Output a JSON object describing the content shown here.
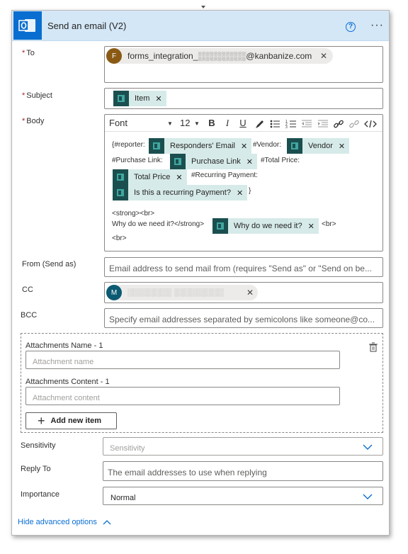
{
  "header": {
    "title": "Send an email (V2)",
    "help": "?",
    "more": "···"
  },
  "to": {
    "label": "To",
    "chip_initial": "F",
    "chip_text": "forms_integration_░░░░░░░░@kanbanize.com"
  },
  "subject": {
    "label": "Subject",
    "token": "Item"
  },
  "body": {
    "label": "Body",
    "toolbar": {
      "font": "Font",
      "size": "12",
      "bold": "B",
      "italic": "I",
      "underline": "U"
    },
    "text_reporter": "{#reporter:",
    "token_responders": "Responders' Email",
    "text_vendor": "#Vendor:",
    "token_vendor": "Vendor",
    "text_purchase": "#Purchase Link:",
    "token_purchase": "Purchase Link",
    "text_total": "#Total Price:",
    "token_total": "Total Price",
    "text_recurring": "#Recurring Payment:",
    "token_recurring": "Is this a recurring Payment?",
    "text_close": "}",
    "text_strong": "<strong><br>",
    "text_why": "Why do we need it?</strong>",
    "token_why": "Why do we need it?",
    "text_br1": "<br>",
    "text_br2": "<br>"
  },
  "from": {
    "label": "From (Send as)",
    "placeholder": "Email address to send mail from (requires \"Send as\" or \"Send on be..."
  },
  "cc": {
    "label": "CC",
    "chip_initial": "M",
    "chip_text": "░░░░░░░░ ░░░░░░░░░"
  },
  "bcc": {
    "label": "BCC",
    "placeholder": "Specify email addresses separated by semicolons like someone@co..."
  },
  "attachments": {
    "name_label": "Attachments Name - 1",
    "name_placeholder": "Attachment name",
    "content_label": "Attachments Content - 1",
    "content_placeholder": "Attachment content",
    "add_label": "Add new item"
  },
  "sensitivity": {
    "label": "Sensitivity",
    "placeholder": "Sensitivity"
  },
  "reply_to": {
    "label": "Reply To",
    "placeholder": "The email addresses to use when replying"
  },
  "importance": {
    "label": "Importance",
    "value": "Normal"
  },
  "advanced": {
    "label": "Hide advanced options"
  },
  "colors": {
    "accent": "#0a6ed1",
    "token_bg": "#d6ebe9",
    "token_icon": "#1b4f4f",
    "header_bg": "#d4e7f7"
  }
}
